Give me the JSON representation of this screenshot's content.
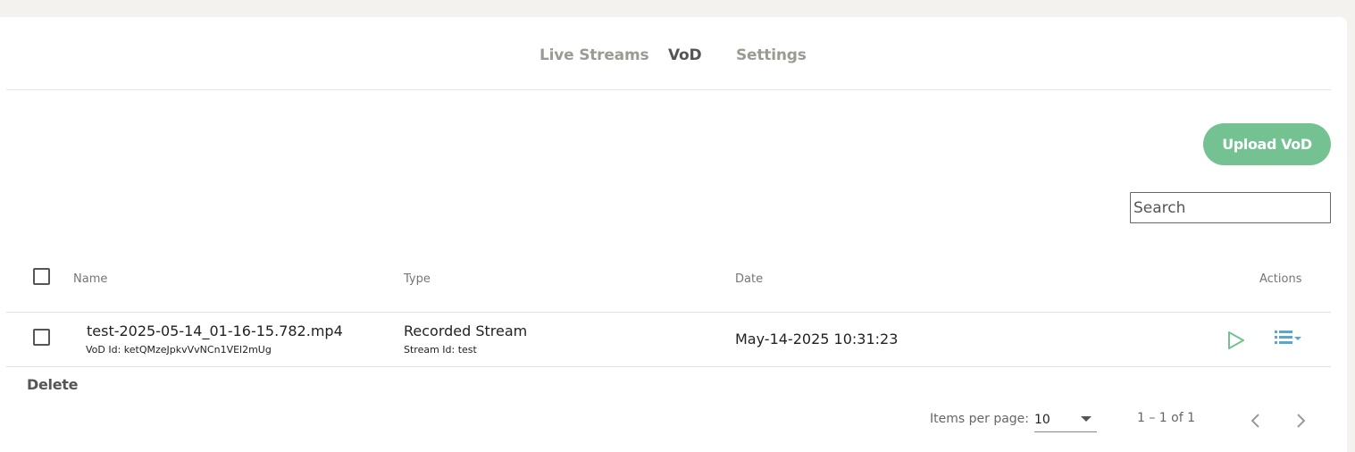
{
  "tabs": [
    {
      "label": "Live Streams",
      "active": false
    },
    {
      "label": "VoD",
      "active": true
    },
    {
      "label": "Settings",
      "active": false
    }
  ],
  "toolbar": {
    "upload_label": "Upload VoD",
    "search_placeholder": "Search",
    "search_value": ""
  },
  "table": {
    "columns": {
      "name": "Name",
      "type": "Type",
      "date": "Date",
      "actions": "Actions"
    },
    "rows": [
      {
        "name": "test-2025-05-14_01-16-15.782.mp4",
        "vod_id": "VoD Id: ketQMzeJpkvVvNCn1VEl2mUg",
        "type": "Recorded Stream",
        "stream_id": "Stream Id: test",
        "date": "May-14-2025 10:31:23",
        "actions": [
          "play-icon",
          "list-menu-icon"
        ]
      }
    ]
  },
  "bulk": {
    "delete_label": "Delete"
  },
  "paginator": {
    "items_per_page_label": "Items per page:",
    "items_per_page_value": "10",
    "range_label": "1 – 1 of 1"
  },
  "colors": {
    "accent": "#74c192",
    "action_icon": "#5aa7c8",
    "tab_inactive": "#9b9b94",
    "tab_active": "#555555",
    "page_background": "#f3f2ef"
  }
}
